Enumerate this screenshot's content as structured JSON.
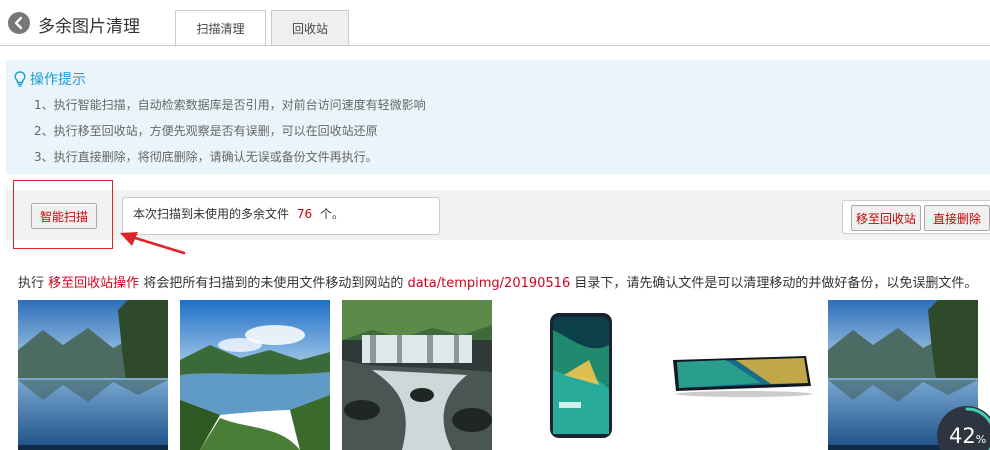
{
  "header": {
    "title": "多余图片清理",
    "tabs": [
      {
        "label": "扫描清理",
        "active": true
      },
      {
        "label": "回收站",
        "active": false
      }
    ]
  },
  "tips": {
    "title": "操作提示",
    "items": [
      "1、执行智能扫描，自动检索数据库是否引用，对前台访问速度有轻微影响",
      "2、执行移至回收站，方便先观察是否有误删，可以在回收站还原",
      "3、执行直接删除，将彻底删除，请确认无误或备份文件再执行。"
    ]
  },
  "actions": {
    "scan_label": "智能扫描",
    "result_prefix": "本次扫描到未使用的多余文件",
    "result_count": "76",
    "result_suffix": "个。",
    "move_label": "移至回收站",
    "delete_label": "直接删除"
  },
  "instruction": {
    "part1": "执行",
    "highlight1": "移至回收站操作",
    "part2": "将会把所有扫描到的未使用文件移动到网站的",
    "highlight2": "data/tempimg/20190516",
    "part3": "目录下，请先确认文件是可以清理移动的并做好备份，以免误删文件。"
  },
  "images": [
    {
      "name": "mountain-lake-image"
    },
    {
      "name": "river-valley-image"
    },
    {
      "name": "waterfall-image"
    },
    {
      "name": "phone-front-image"
    },
    {
      "name": "phone-side-image"
    },
    {
      "name": "mountain-lake-image-2"
    }
  ],
  "progress": {
    "value": 42,
    "unit": "%"
  },
  "colors": {
    "accent_blue": "#1e9ad6",
    "danger_red": "#c00",
    "tips_bg": "#eaf5fb"
  }
}
